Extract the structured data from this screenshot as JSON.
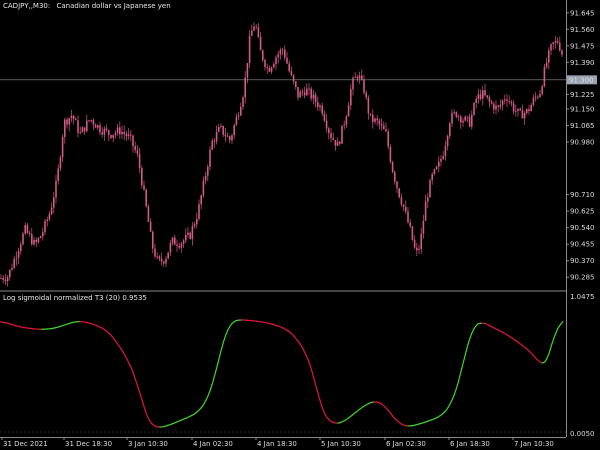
{
  "header": {
    "symbol": "CADJPY,,M30:",
    "description": "Canadian dollar vs Japanese yen"
  },
  "indicator": {
    "label": "Log sigmoidal normalized T3 (20) 0.9535",
    "top_label": "1.0475",
    "bottom_label": "0.0050"
  },
  "colors": {
    "background": "#000000",
    "candle": "#d25a86",
    "rising": "#41d42c",
    "falling": "#e0143c",
    "grid": "#5a5a5a",
    "separator": "#8a8a8a"
  },
  "price_axis": {
    "ticks": [
      "91.645",
      "91.560",
      "91.475",
      "91.390",
      "91.225",
      "91.150",
      "91.065",
      "90.980",
      "90.710",
      "90.625",
      "90.540",
      "90.455",
      "90.370",
      "90.285"
    ],
    "current_price": "91.300"
  },
  "time_axis": {
    "labels": [
      "31 Dec 2021",
      "31 Dec 18:30",
      "3 Jan 10:30",
      "4 Jan 02:30",
      "4 Jan 18:30",
      "5 Jan 10:30",
      "6 Jan 02:30",
      "6 Jan 18:30",
      "7 Jan 10:30"
    ]
  },
  "chart_data": [
    {
      "type": "candlestick",
      "title": "CADJPY,,M30:  Canadian dollar vs Japanese yen",
      "ylim": [
        90.24,
        91.69
      ],
      "x": [
        "31 Dec 2021",
        "31 Dec 18:30",
        "3 Jan 10:30",
        "4 Jan 02:30",
        "4 Jan 18:30",
        "5 Jan 10:30",
        "6 Jan 02:30",
        "6 Jan 18:30",
        "7 Jan 10:30"
      ],
      "close_path": [
        [
          0,
          90.28
        ],
        [
          8,
          90.29
        ],
        [
          18,
          90.43
        ],
        [
          25,
          90.53
        ],
        [
          35,
          90.45
        ],
        [
          42,
          90.51
        ],
        [
          50,
          90.62
        ],
        [
          57,
          90.78
        ],
        [
          64,
          91.08
        ],
        [
          72,
          91.12
        ],
        [
          80,
          91.02
        ],
        [
          90,
          91.1
        ],
        [
          100,
          91.05
        ],
        [
          110,
          91.02
        ],
        [
          120,
          91.04
        ],
        [
          130,
          91.0
        ],
        [
          138,
          90.9
        ],
        [
          145,
          90.68
        ],
        [
          152,
          90.45
        ],
        [
          158,
          90.36
        ],
        [
          165,
          90.38
        ],
        [
          172,
          90.47
        ],
        [
          180,
          90.46
        ],
        [
          190,
          90.5
        ],
        [
          198,
          90.62
        ],
        [
          205,
          90.8
        ],
        [
          212,
          90.98
        ],
        [
          220,
          91.05
        ],
        [
          230,
          90.99
        ],
        [
          238,
          91.13
        ],
        [
          244,
          91.25
        ],
        [
          250,
          91.52
        ],
        [
          255,
          91.6
        ],
        [
          260,
          91.45
        ],
        [
          268,
          91.35
        ],
        [
          276,
          91.42
        ],
        [
          283,
          91.46
        ],
        [
          290,
          91.33
        ],
        [
          298,
          91.22
        ],
        [
          306,
          91.25
        ],
        [
          314,
          91.2
        ],
        [
          322,
          91.15
        ],
        [
          330,
          91.02
        ],
        [
          338,
          90.96
        ],
        [
          346,
          91.12
        ],
        [
          352,
          91.28
        ],
        [
          358,
          91.33
        ],
        [
          364,
          91.25
        ],
        [
          370,
          91.1
        ],
        [
          378,
          91.08
        ],
        [
          386,
          91.02
        ],
        [
          392,
          90.85
        ],
        [
          398,
          90.73
        ],
        [
          404,
          90.64
        ],
        [
          410,
          90.53
        ],
        [
          416,
          90.4
        ],
        [
          420,
          90.45
        ],
        [
          426,
          90.68
        ],
        [
          432,
          90.8
        ],
        [
          438,
          90.85
        ],
        [
          444,
          90.94
        ],
        [
          450,
          91.1
        ],
        [
          456,
          91.13
        ],
        [
          462,
          91.1
        ],
        [
          470,
          91.08
        ],
        [
          476,
          91.2
        ],
        [
          482,
          91.23
        ],
        [
          490,
          91.18
        ],
        [
          498,
          91.15
        ],
        [
          506,
          91.22
        ],
        [
          514,
          91.15
        ],
        [
          520,
          91.12
        ],
        [
          528,
          91.14
        ],
        [
          534,
          91.2
        ],
        [
          540,
          91.24
        ],
        [
          546,
          91.38
        ],
        [
          552,
          91.48
        ],
        [
          558,
          91.5
        ],
        [
          563,
          91.42
        ]
      ]
    },
    {
      "type": "line",
      "title": "Log sigmoidal normalized T3 (20) 0.9535",
      "ylim": [
        0.005,
        1.0475
      ],
      "series": [
        {
          "color_rule": "green while rising, red while falling",
          "points": [
            [
              0,
              0.88
            ],
            [
              20,
              0.83
            ],
            [
              40,
              0.81
            ],
            [
              55,
              0.82
            ],
            [
              65,
              0.85
            ],
            [
              78,
              0.88
            ],
            [
              92,
              0.86
            ],
            [
              108,
              0.8
            ],
            [
              122,
              0.65
            ],
            [
              135,
              0.45
            ],
            [
              143,
              0.2
            ],
            [
              150,
              0.05
            ],
            [
              158,
              0.02
            ],
            [
              168,
              0.04
            ],
            [
              180,
              0.08
            ],
            [
              192,
              0.12
            ],
            [
              200,
              0.16
            ],
            [
              208,
              0.26
            ],
            [
              214,
              0.4
            ],
            [
              220,
              0.62
            ],
            [
              226,
              0.8
            ],
            [
              232,
              0.88
            ],
            [
              240,
              0.89
            ],
            [
              255,
              0.88
            ],
            [
              270,
              0.86
            ],
            [
              285,
              0.82
            ],
            [
              296,
              0.75
            ],
            [
              306,
              0.62
            ],
            [
              314,
              0.45
            ],
            [
              320,
              0.2
            ],
            [
              326,
              0.1
            ],
            [
              334,
              0.05
            ],
            [
              344,
              0.07
            ],
            [
              356,
              0.15
            ],
            [
              368,
              0.22
            ],
            [
              376,
              0.24
            ],
            [
              384,
              0.21
            ],
            [
              392,
              0.12
            ],
            [
              400,
              0.05
            ],
            [
              408,
              0.03
            ],
            [
              418,
              0.05
            ],
            [
              430,
              0.08
            ],
            [
              442,
              0.12
            ],
            [
              452,
              0.22
            ],
            [
              460,
              0.42
            ],
            [
              466,
              0.65
            ],
            [
              472,
              0.82
            ],
            [
              480,
              0.88
            ],
            [
              490,
              0.84
            ],
            [
              505,
              0.78
            ],
            [
              520,
              0.7
            ],
            [
              532,
              0.62
            ],
            [
              542,
              0.52
            ],
            [
              547,
              0.54
            ],
            [
              552,
              0.7
            ],
            [
              558,
              0.85
            ],
            [
              563,
              0.9
            ]
          ]
        }
      ]
    }
  ]
}
